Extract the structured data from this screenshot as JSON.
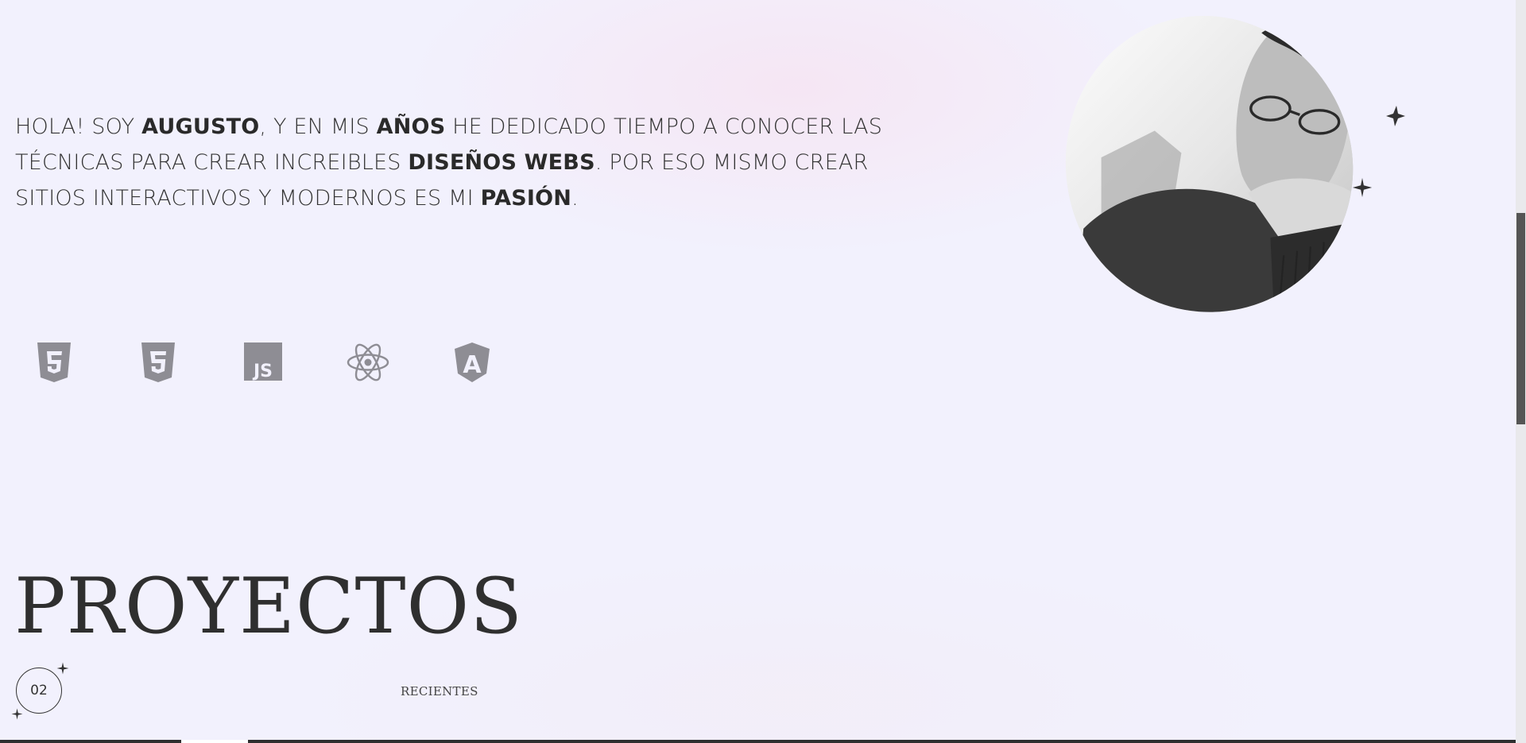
{
  "about": {
    "p1": "HOLA! SOY ",
    "name": "AUGUSTO",
    "p2": ", Y EN MIS ",
    "years": "AÑOS",
    "p3": " HE DEDICADO TIEMPO A CONOCER LAS TÉCNICAS PARA CREAR INCREIBLES ",
    "web_designs": "DISEÑOS WEBS",
    "p4": ". POR ESO MISMO CREAR SITIOS INTERACTIVOS Y MODERNOS ES MI ",
    "passion": "PASIÓN",
    "p5": "."
  },
  "tech_icons": [
    "html5-icon",
    "css3-icon",
    "javascript-icon",
    "react-icon",
    "angular-icon"
  ],
  "tech_labels": {
    "javascript": "JS",
    "angular": "A"
  },
  "projects": {
    "title": "PROYECTOS",
    "number": "02",
    "subtitle": "RECIENTES"
  },
  "colors": {
    "background": "#f2f1fd",
    "text": "#333333",
    "icon_gray": "#8e8d94",
    "accent_pink": "#f6e4f2"
  }
}
